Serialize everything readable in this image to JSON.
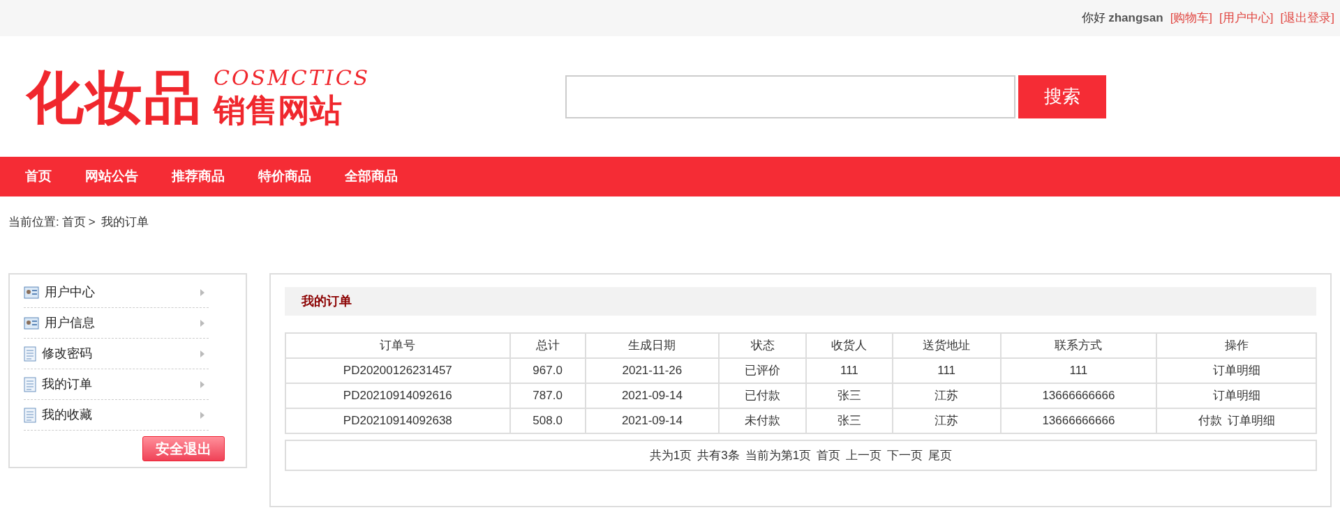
{
  "top_bar": {
    "greeting": "你好",
    "username": "zhangsan",
    "links": [
      "[购物车]",
      "[用户中心]",
      "[退出登录]"
    ]
  },
  "logo": {
    "main": "化妆品",
    "sub": "销售网站",
    "english": "COSMCTICS"
  },
  "search": {
    "button": "搜索"
  },
  "nav": [
    "首页",
    "网站公告",
    "推荐商品",
    "特价商品",
    "全部商品"
  ],
  "breadcrumb": {
    "label": "当前位置:",
    "home": "首页",
    "separator": ">",
    "current": "我的订单"
  },
  "sidebar": {
    "items": [
      {
        "label": "用户中心",
        "kind": "card"
      },
      {
        "label": "用户信息",
        "kind": "card"
      },
      {
        "label": "修改密码",
        "kind": "doc"
      },
      {
        "label": "我的订单",
        "kind": "doc"
      },
      {
        "label": "我的收藏",
        "kind": "doc"
      }
    ],
    "logout": "安全退出"
  },
  "panel": {
    "title": "我的订单"
  },
  "table": {
    "columns": [
      "订单号",
      "总计",
      "生成日期",
      "状态",
      "收货人",
      "送货地址",
      "联系方式",
      "操作"
    ],
    "rows": [
      {
        "cells": [
          "PD20200126231457",
          "967.0",
          "2021-11-26",
          "已评价",
          "111",
          "111",
          "111"
        ],
        "actions": [
          "订单明细"
        ]
      },
      {
        "cells": [
          "PD20210914092616",
          "787.0",
          "2021-09-14",
          "已付款",
          "张三",
          "江苏",
          "13666666666"
        ],
        "actions": [
          "订单明细"
        ]
      },
      {
        "cells": [
          "PD20210914092638",
          "508.0",
          "2021-09-14",
          "未付款",
          "张三",
          "江苏",
          "13666666666"
        ],
        "actions": [
          "付款",
          "订单明细"
        ]
      }
    ]
  },
  "pagination": [
    "共为1页",
    "共有3条",
    "当前为第1页",
    "首页",
    "上一页",
    "下一页",
    "尾页"
  ]
}
